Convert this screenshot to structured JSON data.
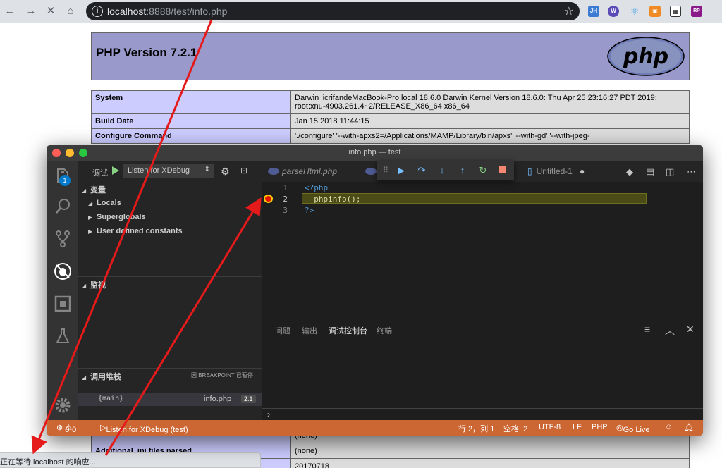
{
  "browser": {
    "url_host": "localhost",
    "url_rest": ":8888/test/info.php",
    "extensions": [
      "JH",
      "W",
      "RP"
    ]
  },
  "phpinfo": {
    "title": "PHP Version 7.2.1",
    "logo_text": "php",
    "rows": [
      {
        "key": "System",
        "value": "Darwin licrifandeMacBook-Pro.local 18.6.0 Darwin Kernel Version 18.6.0: Thu Apr 25 23:16:27 PDT 2019; root:xnu-4903.261.4~2/RELEASE_X86_64 x86_64"
      },
      {
        "key": "Build Date",
        "value": "Jan 15 2018 11:44:15"
      },
      {
        "key": "Configure Command",
        "value": "'./configure' '--with-apxs2=/Applications/MAMP/Library/bin/apxs' '--with-gd' '--with-jpeg-"
      }
    ],
    "bottom_rows": [
      {
        "key": "Additional .ini files parsed",
        "value": "(none)"
      },
      {
        "key": "",
        "value": "20170718"
      }
    ],
    "partial_row_value": "(none)"
  },
  "browser_status": "正在等待 localhost 的响应...",
  "vscode": {
    "window_title": "info.php — test",
    "activity_badge": "1",
    "debug": {
      "label": "调试",
      "config": "Listen for XDebug"
    },
    "sections": {
      "variables": "变量",
      "watch": "监视",
      "callstack": "调用堆栈",
      "breakpoint_status": "因 BREAKPOINT 已暂停"
    },
    "variables": [
      "Locals",
      "Superglobals",
      "User defined constants"
    ],
    "callstack": {
      "fn": "{main}",
      "file": "info.php",
      "pos": "2:1"
    },
    "tabs": [
      {
        "label": "parseHtml.php"
      },
      {
        "label": "Untitled-1"
      }
    ],
    "code": {
      "line_numbers": [
        "1",
        "2",
        "3"
      ],
      "lines": [
        "<?php",
        "  phpinfo();",
        "?>"
      ]
    },
    "panel_tabs": [
      "问题",
      "输出",
      "调试控制台",
      "终端"
    ],
    "repl_prompt": "›",
    "status": {
      "errors": "0",
      "warnings": "0",
      "debug": "Listen for XDebug (test)",
      "position": "行 2，列 1",
      "spaces": "空格: 2",
      "encoding": "UTF-8",
      "eol": "LF",
      "language": "PHP",
      "golive": "Go Live"
    }
  },
  "colors": {
    "php_header": "#9999cc",
    "php_key": "#ccccff",
    "php_value": "#dddddd",
    "statusbar_debug": "#cc6633",
    "annotation": "#e51a1a"
  }
}
